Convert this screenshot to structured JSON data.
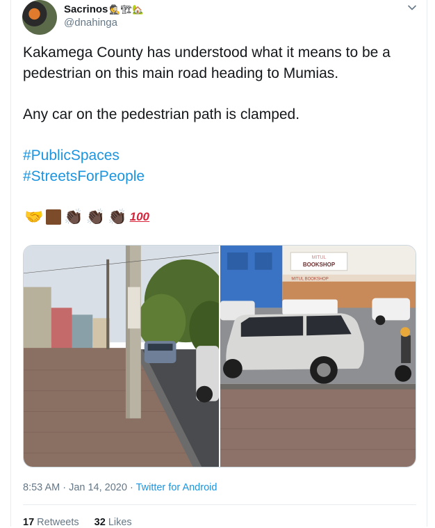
{
  "tweet": {
    "display_name": "Sacrinos",
    "name_emojis": "🕵🏗🏡",
    "handle": "@dnahinga",
    "paragraph1": "Kakamega County has understood what it means to be a pedestrian on this main road heading to Mumias.",
    "paragraph2": "Any car on the pedestrian path is clamped.",
    "hashtags": [
      "#PublicSpaces",
      "#StreetsForPeople"
    ],
    "emojis": {
      "handshake": "🤝",
      "clap": "👏🏿",
      "hundred": "100"
    },
    "photos": {
      "photo1_sign": "",
      "photo2_sign_top": "MITUL",
      "photo2_sign_main": "BOOKSHOP",
      "photo2_sign_lower": "MITUL BOOKSHOP"
    },
    "time": "8:53 AM · Jan 14, 2020 · ",
    "source": "Twitter for Android",
    "retweets_count": "17",
    "retweets_label": "Retweets",
    "likes_count": "32",
    "likes_label": "Likes"
  },
  "colors": {
    "link": "#1b95e0",
    "muted": "#657786",
    "text": "#14171a",
    "border": "#e6ecf0"
  },
  "icons": [
    "chevron-down-icon"
  ]
}
